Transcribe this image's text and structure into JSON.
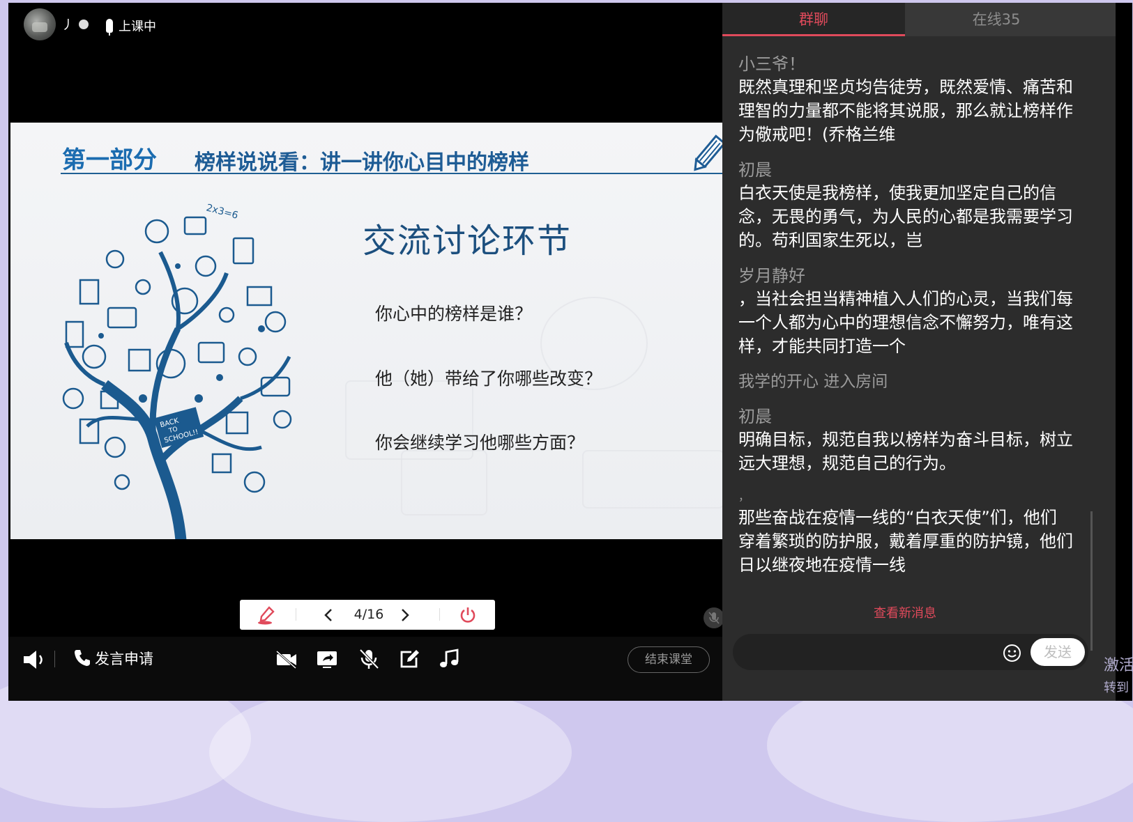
{
  "header": {
    "username": "丿",
    "status": "上课中"
  },
  "slide": {
    "part_label": "第一部分",
    "subtitle": "榜样说说看：讲一讲你心目中的榜样",
    "main_title": "交流讨论环节",
    "questions": [
      "你心中的榜样是谁？",
      "他（她）带给了你哪些改变？",
      "你会继续学习他哪些方面？"
    ],
    "tree_text": {
      "back_to_school_1": "BACK",
      "back_to_school_2": "TO",
      "back_to_school_3": "SCHOOL!!",
      "math": "2x3=6"
    }
  },
  "controls": {
    "page_indicator": "4/16"
  },
  "bottombar": {
    "apply_label": "发言申请",
    "end_class": "结束课堂"
  },
  "chat": {
    "tab_group": "群聊",
    "tab_online": "在线35",
    "messages": [
      {
        "name": "小三爷！",
        "text": "既然真理和坚贞均告徒劳，既然爱情、痛苦和理智的力量都不能将其说服，那么就让榜样作为儆戒吧！(乔格兰维"
      },
      {
        "name": "初晨",
        "text": "白衣天使是我榜样，使我更加坚定自己的信念，无畏的勇气，为人民的心都是我需要学习的。苟利国家生死以，岂"
      },
      {
        "name": "岁月静好",
        "text": "，当社会担当精神植入人们的心灵，当我们每一个人都为心中的理想信念不懈努力，唯有这样，才能共同打造一个"
      }
    ],
    "system_message": "我学的开心 进入房间",
    "messages2": [
      {
        "name": "初晨",
        "text": "明确目标，规范自我以榜样为奋斗目标，树立远大理想，规范自己的行为。"
      },
      {
        "name": "，",
        "text": "那些奋战在疫情一线的“白衣天使”们，他们穿着繁琐的防护服，戴着厚重的防护镜，他们日以继夜地在疫情一线"
      }
    ],
    "new_messages": "查看新消息",
    "send_label": "发送"
  },
  "watermark": {
    "line1": "激活",
    "line2": "转到"
  },
  "colors": {
    "accent": "#e04a5b",
    "slide_blue": "#1e5c95",
    "page_bg": "#cfc8ee"
  }
}
